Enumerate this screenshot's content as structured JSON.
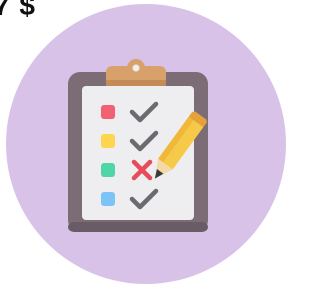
{
  "price_label": "7 $",
  "colors": {
    "circle_bg": "#d8c2e8",
    "board": "#7b6c76",
    "board_shadow": "#6a5c66",
    "paper": "#eeeef0",
    "clip": "#d8a06a",
    "check": "#6a6a70",
    "cross": "#e84b5c",
    "pencil": "#f7c948",
    "pencil_tip": "#3a3a3a"
  },
  "illustration": {
    "name": "clipboard-checklist-icon",
    "items": [
      {
        "marker_color": "#f26072",
        "status": "check"
      },
      {
        "marker_color": "#fdd54f",
        "status": "check"
      },
      {
        "marker_color": "#4fd6a7",
        "status": "cross"
      },
      {
        "marker_color": "#7cc4f7",
        "status": "check"
      }
    ]
  }
}
